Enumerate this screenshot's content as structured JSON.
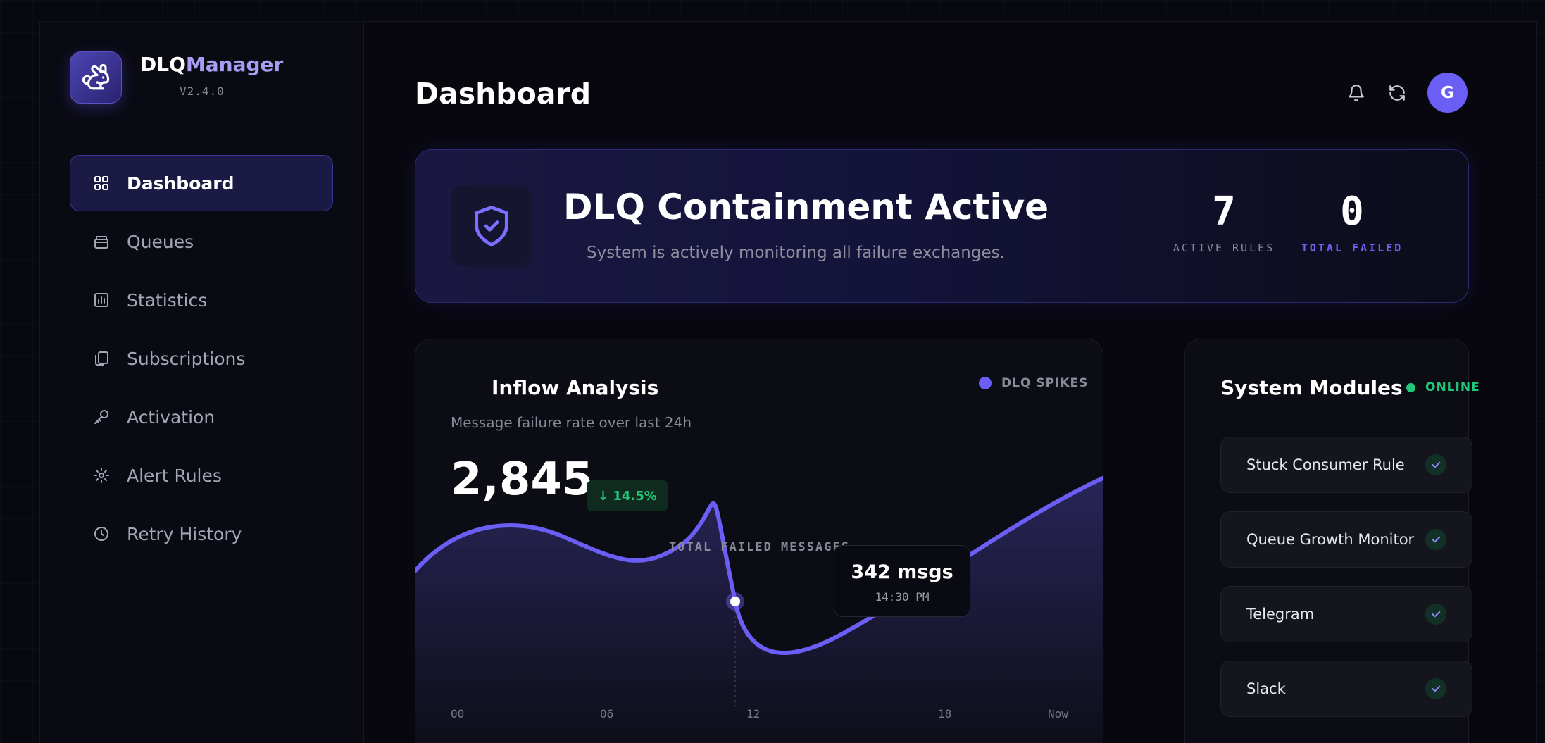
{
  "brand": {
    "name_part1": "DLQ",
    "name_part2": "Manager",
    "version": "V2.4.0"
  },
  "sidebar": {
    "items": [
      {
        "label": "Dashboard",
        "icon": "grid-icon",
        "active": true
      },
      {
        "label": "Queues",
        "icon": "inbox-icon",
        "active": false
      },
      {
        "label": "Statistics",
        "icon": "bar-chart-icon",
        "active": false
      },
      {
        "label": "Subscriptions",
        "icon": "copy-icon",
        "active": false
      },
      {
        "label": "Activation",
        "icon": "key-icon",
        "active": false
      },
      {
        "label": "Alert Rules",
        "icon": "gear-icon",
        "active": false
      },
      {
        "label": "Retry History",
        "icon": "clock-icon",
        "active": false
      }
    ]
  },
  "header": {
    "title": "Dashboard",
    "avatar_initial": "G"
  },
  "banner": {
    "title": "DLQ Containment Active",
    "subtitle": "System is actively monitoring all failure exchanges.",
    "active_rules_value": "7",
    "active_rules_label": "ACTIVE RULES",
    "total_failed_value": "0",
    "total_failed_label": "TOTAL FAILED"
  },
  "inflow": {
    "title": "Inflow Analysis",
    "subtitle": "Message failure rate over last 24h",
    "legend": "DLQ SPIKES",
    "total": "2,845",
    "delta": "↓ 14.5%",
    "total_label": "TOTAL FAILED MESSAGES",
    "tooltip_value": "342 msgs",
    "tooltip_time": "14:30 PM",
    "x_ticks": [
      "00",
      "06",
      "12",
      "18",
      "Now"
    ]
  },
  "chart_data": {
    "type": "line",
    "x": [
      "00",
      "06",
      "12",
      "18",
      "Now"
    ],
    "series": [
      {
        "name": "DLQ SPIKES"
      }
    ],
    "highlight": {
      "time": "14:30 PM",
      "value": "342 msgs"
    }
  },
  "modules": {
    "title": "System Modules",
    "status": "ONLINE",
    "items": [
      {
        "label": "Stuck Consumer Rule"
      },
      {
        "label": "Queue Growth Monitor"
      },
      {
        "label": "Telegram"
      },
      {
        "label": "Slack"
      }
    ]
  },
  "colors": {
    "accent": "#6b5ef5",
    "success": "#22c77a",
    "background": "#07070d"
  }
}
